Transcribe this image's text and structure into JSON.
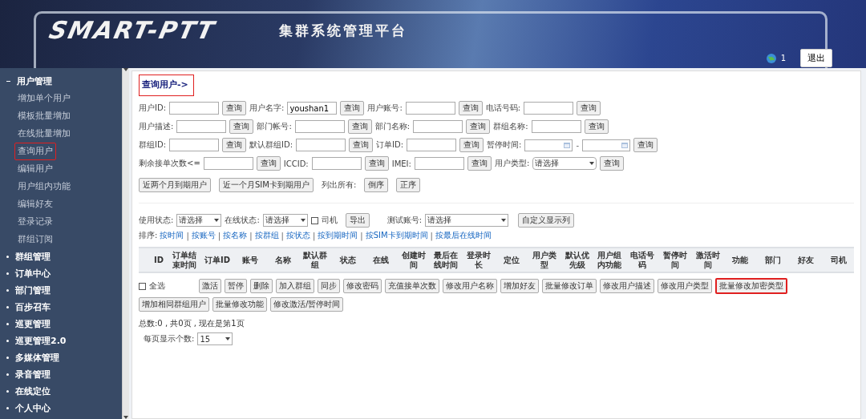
{
  "header": {
    "logo": "SMART-PTT",
    "title": "集群系统管理平台",
    "online_count": "1",
    "logout": "退出"
  },
  "sidebar": [
    {
      "label": "用户管理",
      "expanded": true,
      "children": [
        {
          "label": "增加单个用户",
          "selected": false
        },
        {
          "label": "模板批量增加",
          "selected": false
        },
        {
          "label": "在线批量增加",
          "selected": false
        },
        {
          "label": "查询用户",
          "selected": true
        },
        {
          "label": "编辑用户",
          "selected": false
        },
        {
          "label": "用户组内功能",
          "selected": false
        },
        {
          "label": "编辑好友",
          "selected": false
        },
        {
          "label": "登录记录",
          "selected": false
        },
        {
          "label": "群组订阅",
          "selected": false
        }
      ]
    },
    {
      "label": "群组管理",
      "expanded": false
    },
    {
      "label": "订单中心",
      "expanded": false
    },
    {
      "label": "部门管理",
      "expanded": false
    },
    {
      "label": "百步召车",
      "expanded": false
    },
    {
      "label": "巡更管理",
      "expanded": false
    },
    {
      "label": "巡更管理2.0",
      "expanded": false
    },
    {
      "label": "多媒体管理",
      "expanded": false
    },
    {
      "label": "录音管理",
      "expanded": false
    },
    {
      "label": "在线定位",
      "expanded": false
    },
    {
      "label": "个人中心",
      "expanded": false
    }
  ],
  "page_title": {
    "text": "查询用户->",
    "highlighted": true
  },
  "search_rows": [
    [
      {
        "kind": "text",
        "label": "用户ID:",
        "button": "查询"
      },
      {
        "kind": "text",
        "label": "用户名字:",
        "value": "youshan1",
        "button": "查询"
      },
      {
        "kind": "text",
        "label": "用户账号:",
        "button": "查询"
      },
      {
        "kind": "text",
        "label": "电话号码:",
        "button": "查询"
      }
    ],
    [
      {
        "kind": "text",
        "label": "用户描述:",
        "button": "查询"
      },
      {
        "kind": "text",
        "label": "部门帐号:",
        "button": "查询"
      },
      {
        "kind": "text",
        "label": "部门名称:",
        "button": "查询"
      },
      {
        "kind": "text",
        "label": "群组名称:",
        "button": "查询"
      }
    ],
    [
      {
        "kind": "text",
        "label": "群组ID:",
        "button": "查询"
      },
      {
        "kind": "text",
        "label": "默认群组ID:",
        "button": "查询"
      },
      {
        "kind": "text",
        "label": "订单ID:",
        "button": "查询"
      },
      {
        "kind": "daterange",
        "label": "暂停时间:",
        "separator": "-",
        "button": "查询"
      }
    ],
    [
      {
        "kind": "text",
        "label": "剩余接单次数<=",
        "button": "查询"
      },
      {
        "kind": "text",
        "label": "ICCID:",
        "button": "查询"
      },
      {
        "kind": "text",
        "label": "IMEI:",
        "button": "查询"
      },
      {
        "kind": "select",
        "label": "用户类型:",
        "value": "请选择",
        "button": "查询"
      }
    ]
  ],
  "quick_buttons": [
    "近两个月到期用户",
    "近一个月SIM卡到期用户"
  ],
  "list_all": {
    "label": "列出所有:",
    "buttons": [
      "倒序",
      "正序"
    ]
  },
  "filters": {
    "use_status": {
      "label": "使用状态:",
      "value": "请选择"
    },
    "online_status": {
      "label": "在线状态:",
      "value": "请选择"
    },
    "driver": {
      "label": "司机",
      "checked": false
    },
    "export": "导出",
    "test_account": {
      "label": "测试账号:",
      "value": "请选择"
    },
    "custom_columns": "自定义显示列"
  },
  "sort": {
    "label": "排序:",
    "separator": "|",
    "links": [
      "按时间",
      "按账号",
      "按名称",
      "按群组",
      "按状态",
      "按到期时间",
      "按SIM卡到期时间",
      "按最后在线时间"
    ]
  },
  "table": {
    "columns": [
      "ID",
      "订单结束时间",
      "订单ID",
      "账号",
      "名称",
      "默认群组",
      "状态",
      "在线",
      "创建时间",
      "最后在线时间",
      "登录时长",
      "定位",
      "用户类型",
      "默认优先级",
      "用户组内功能",
      "电话号码",
      "暂停时间",
      "激活时间",
      "功能",
      "部门",
      "好友",
      "司机"
    ]
  },
  "select_all": {
    "label": "全选",
    "checked": false
  },
  "actions": [
    {
      "label": "激活",
      "highlighted": false
    },
    {
      "label": "暂停",
      "highlighted": false
    },
    {
      "label": "删除",
      "highlighted": false
    },
    {
      "label": "加入群组",
      "highlighted": false
    },
    {
      "label": "同步",
      "highlighted": false
    },
    {
      "label": "修改密码",
      "highlighted": false
    },
    {
      "label": "充值接单次数",
      "highlighted": false
    },
    {
      "label": "修改用户名称",
      "highlighted": false
    },
    {
      "label": "增加好友",
      "highlighted": false
    },
    {
      "label": "批量修改订单",
      "highlighted": false
    },
    {
      "label": "修改用户描述",
      "highlighted": false
    },
    {
      "label": "修改用户类型",
      "highlighted": false
    },
    {
      "label": "批量修改加密类型",
      "highlighted": true
    },
    {
      "label": "增加相同群组用户",
      "highlighted": false
    },
    {
      "label": "批量修改功能",
      "highlighted": false
    },
    {
      "label": "修改激活/暂停时间",
      "highlighted": false
    }
  ],
  "summary": "总数:0 , 共0页 , 现在是第1页",
  "page_size": {
    "label": "每页显示个数:",
    "value": "15"
  }
}
